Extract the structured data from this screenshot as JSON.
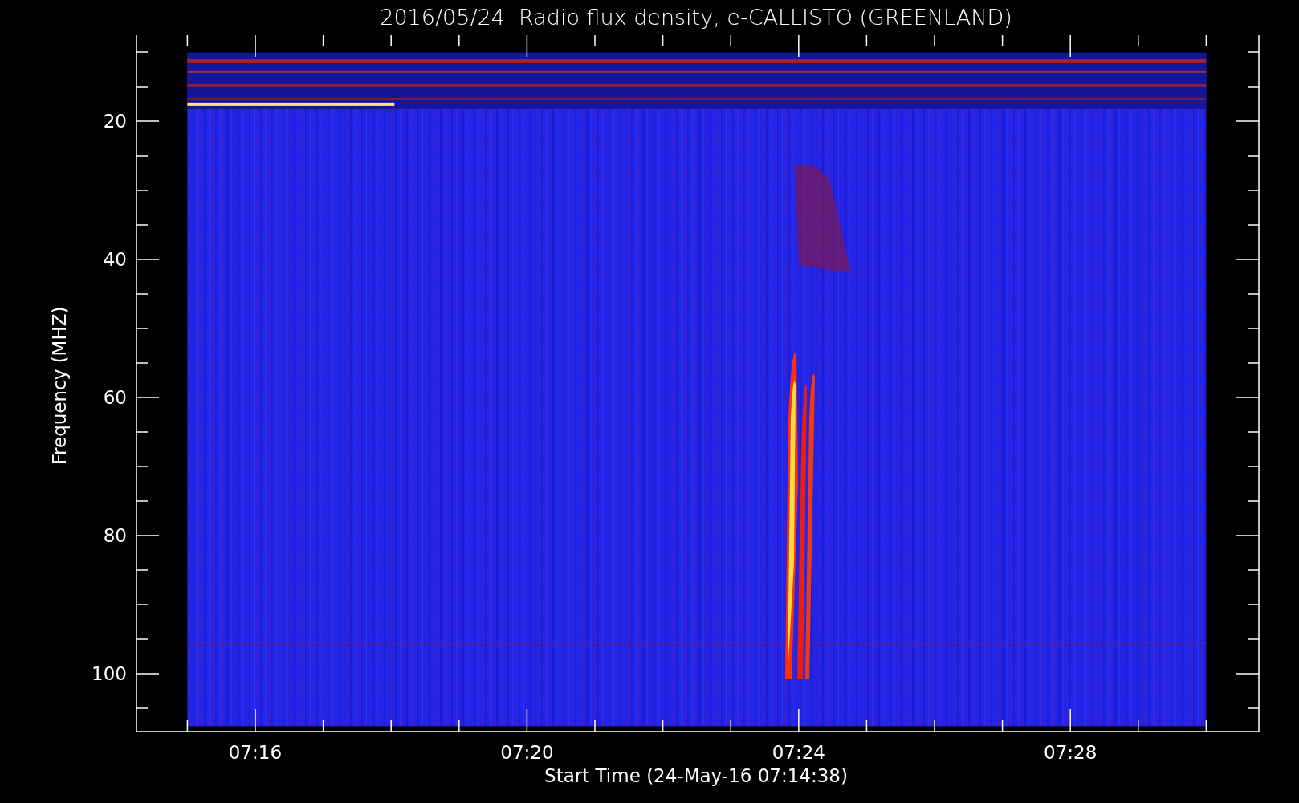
{
  "title": "2016/05/24  Radio flux density, e-CALLISTO (GREENLAND)",
  "y_axis": {
    "label": "Frequency (MHZ)",
    "ticks": [
      "20",
      "40",
      "60",
      "80",
      "100"
    ]
  },
  "x_axis": {
    "label": "Start Time (24-May-16 07:14:38)",
    "ticks": [
      "07:16",
      "07:20",
      "07:24",
      "07:28"
    ]
  }
}
